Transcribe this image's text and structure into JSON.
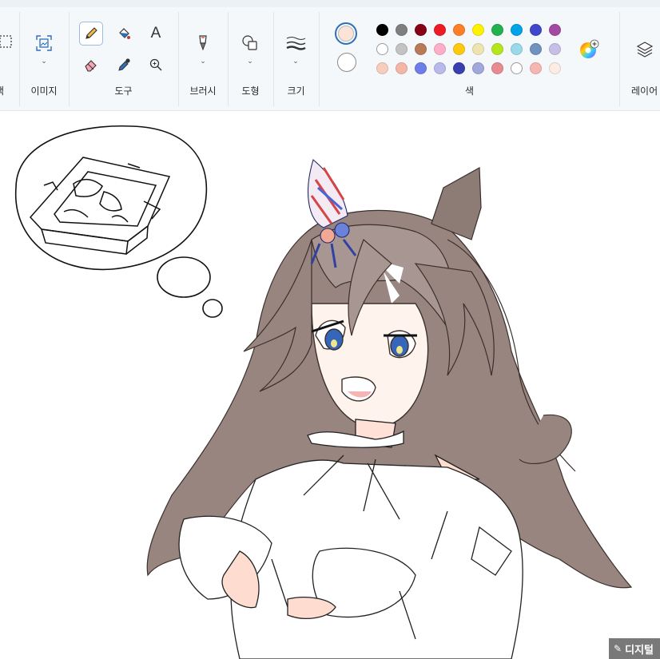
{
  "ribbon": {
    "groups": {
      "select": {
        "label": "택"
      },
      "image": {
        "label": "이미지"
      },
      "tools": {
        "label": "도구"
      },
      "brushes": {
        "label": "브러시"
      },
      "shapes": {
        "label": "도형"
      },
      "size": {
        "label": "크기"
      },
      "colors": {
        "label": "색"
      },
      "layers": {
        "label": "레이어"
      }
    },
    "tools": {
      "pencil": "pencil-icon",
      "fill": "fill-bucket-icon",
      "text": "A",
      "eraser": "eraser-icon",
      "picker": "color-picker-icon",
      "magnifier": "magnifier-icon"
    },
    "active_tool": "pencil",
    "color1": "#fbe3d8",
    "color2": "#ffffff",
    "palette": [
      [
        "#000000",
        "#7f7f7f",
        "#880015",
        "#ed1c24",
        "#ff7f27",
        "#fff200",
        "#22b14c",
        "#00a2e8",
        "#3f48cc",
        "#a349a4"
      ],
      [
        "#ffffff",
        "#c3c3c3",
        "#b97a57",
        "#ffaec9",
        "#ffc90e",
        "#efe4b0",
        "#b5e61d",
        "#99d9ea",
        "#7092be",
        "#c8bfe7"
      ],
      [
        "#f7cdbd",
        "#f4b7a6",
        "#6f7de8",
        "#b9b9ec",
        "#3a3fb0",
        "#a2a8dc",
        "#e88a92",
        "#ffffff",
        "#f6b6b2",
        "#fbece4"
      ]
    ]
  },
  "watermark": {
    "text": "디지털"
  }
}
